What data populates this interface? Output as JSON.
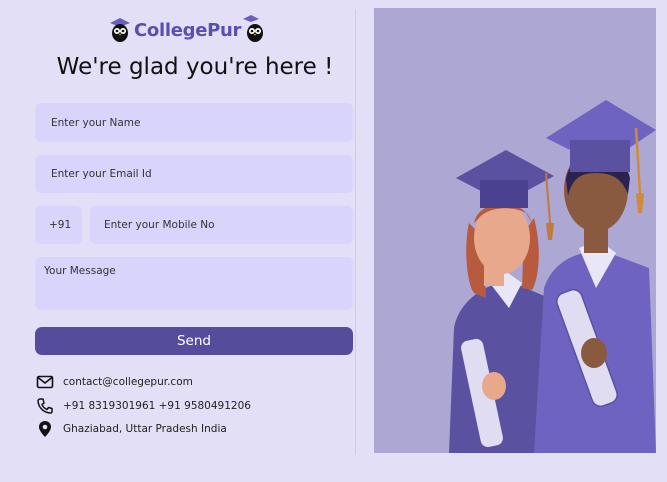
{
  "brand": {
    "name": "CollegePur"
  },
  "heading": "We're glad you're here !",
  "form": {
    "name_placeholder": "Enter your Name",
    "email_placeholder": "Enter your Email Id",
    "country_code": "+91",
    "mobile_placeholder": "Enter your Mobile No",
    "message_placeholder": "Your Message",
    "send_label": "Send"
  },
  "contact": {
    "email": "contact@collegepur.com",
    "phone": "+91 8319301961 +91 9580491206",
    "address": "Ghaziabad, Uttar Pradesh India"
  },
  "icons": {
    "mail": "mail-icon",
    "phone": "phone-icon",
    "location": "location-pin-icon"
  },
  "colors": {
    "page_bg": "#e2dff6",
    "field_bg": "#d9d4fc",
    "button_bg": "#564c9c",
    "brand": "#5a4fb0",
    "hero_bg": "#aca7d3"
  }
}
